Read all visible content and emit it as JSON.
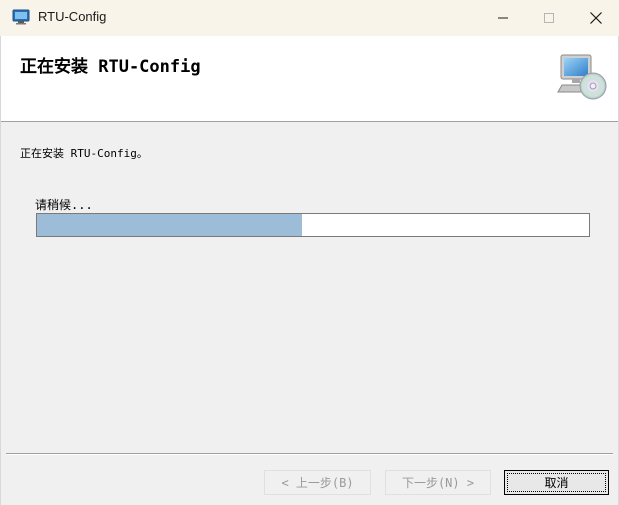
{
  "window": {
    "title": "RTU-Config",
    "app_icon": "installer-computer-icon",
    "controls": {
      "minimize_icon": "minimize-icon",
      "maximize_icon": "maximize-icon",
      "close_icon": "close-icon"
    }
  },
  "header": {
    "title": "正在安装 RTU-Config",
    "graphic_icon": "computer-disc-icon"
  },
  "body": {
    "status_text": "正在安装 RTU-Config。",
    "wait_label": "请稍候...",
    "progress_fraction": 0.48
  },
  "footer": {
    "back_label": "< 上一步(B)",
    "next_label": "下一步(N) >",
    "cancel_label": "取消"
  },
  "colors": {
    "progress_fill": "#9dbcd8",
    "titlebar_bg": "#f8f4ea",
    "window_bg": "#f0f0f0"
  }
}
